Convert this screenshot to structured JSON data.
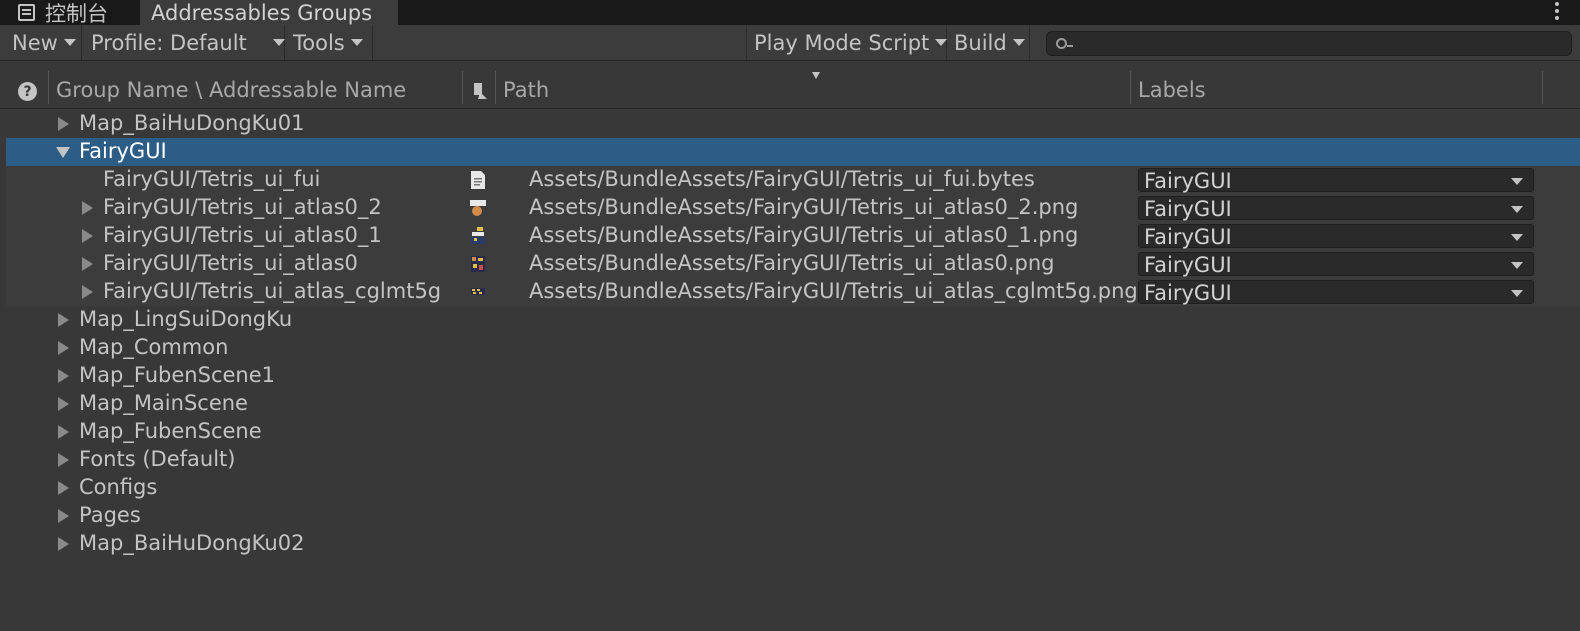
{
  "tabs": {
    "console": "控制台",
    "addressables": "Addressables Groups"
  },
  "toolbar": {
    "new": "New",
    "profile": "Profile: Default",
    "tools": "Tools",
    "play_mode_script": "Play Mode Script",
    "build": "Build",
    "search_value": ""
  },
  "header": {
    "group_name": "Group Name \\ Addressable Name",
    "path": "Path",
    "labels": "Labels"
  },
  "groups": [
    {
      "name": "Map_BaiHuDongKu01",
      "expanded": false
    },
    {
      "name": "FairyGUI",
      "expanded": true,
      "selected": true
    },
    {
      "name": "Map_LingSuiDongKu",
      "expanded": false
    },
    {
      "name": "Map_Common",
      "expanded": false
    },
    {
      "name": "Map_FubenScene1",
      "expanded": false
    },
    {
      "name": "Map_MainScene",
      "expanded": false
    },
    {
      "name": "Map_FubenScene",
      "expanded": false
    },
    {
      "name": "Fonts (Default)",
      "expanded": false
    },
    {
      "name": "Configs",
      "expanded": false
    },
    {
      "name": "Pages",
      "expanded": false
    },
    {
      "name": "Map_BaiHuDongKu02",
      "expanded": false
    }
  ],
  "entries": [
    {
      "name": "FairyGUI/Tetris_ui_fui",
      "path": "Assets/BundleAssets/FairyGUI/Tetris_ui_fui.bytes",
      "label": "FairyGUI",
      "icon": "text-file-icon",
      "has_children": false
    },
    {
      "name": "FairyGUI/Tetris_ui_atlas0_2",
      "path": "Assets/BundleAssets/FairyGUI/Tetris_ui_atlas0_2.png",
      "label": "FairyGUI",
      "icon": "texture-icon",
      "has_children": true
    },
    {
      "name": "FairyGUI/Tetris_ui_atlas0_1",
      "path": "Assets/BundleAssets/FairyGUI/Tetris_ui_atlas0_1.png",
      "label": "FairyGUI",
      "icon": "texture-icon",
      "has_children": true
    },
    {
      "name": "FairyGUI/Tetris_ui_atlas0",
      "path": "Assets/BundleAssets/FairyGUI/Tetris_ui_atlas0.png",
      "label": "FairyGUI",
      "icon": "texture-icon",
      "has_children": true
    },
    {
      "name": "FairyGUI/Tetris_ui_atlas_cglmt5g",
      "path": "Assets/BundleAssets/FairyGUI/Tetris_ui_atlas_cglmt5g.png",
      "label": "FairyGUI",
      "icon": "texture-icon",
      "has_children": true
    }
  ],
  "colors": {
    "background": "#383838",
    "selection": "#2c5d87",
    "text": "#c4c4c4"
  }
}
